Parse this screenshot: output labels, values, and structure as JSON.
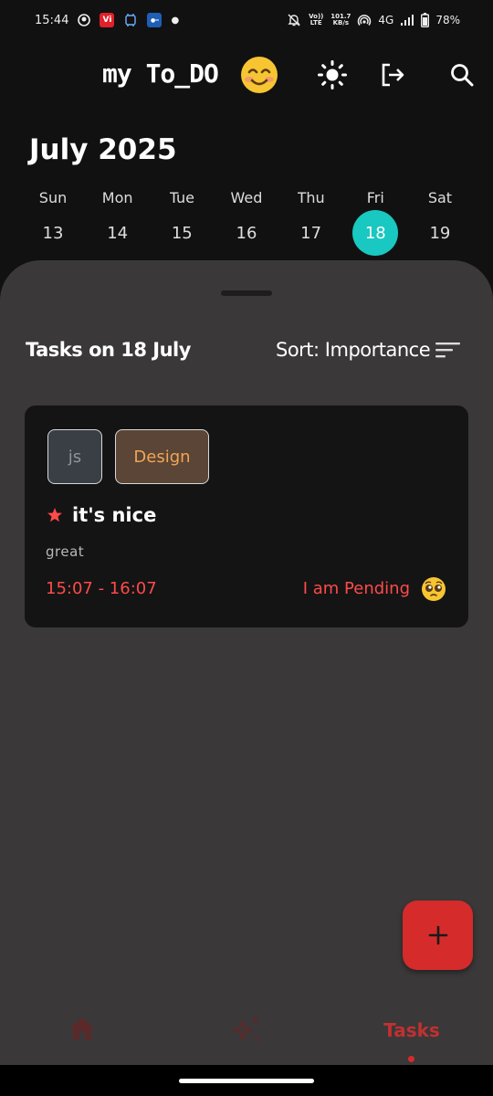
{
  "status_bar": {
    "time": "15:44",
    "net_type": "Vo)) LTE",
    "speed_value": "101.7",
    "speed_unit": "KB/s",
    "network": "4G",
    "battery": "78%"
  },
  "app_bar": {
    "title": "my To_DO",
    "title_emoji_icon": "smiling-face-icon",
    "theme_icon": "sun-icon",
    "logout_icon": "logout-icon",
    "search_icon": "search-icon"
  },
  "calendar": {
    "month_label": "July 2025",
    "days": [
      {
        "name": "Sun",
        "num": "13"
      },
      {
        "name": "Mon",
        "num": "14"
      },
      {
        "name": "Tue",
        "num": "15"
      },
      {
        "name": "Wed",
        "num": "16"
      },
      {
        "name": "Thu",
        "num": "17"
      },
      {
        "name": "Fri",
        "num": "18"
      },
      {
        "name": "Sat",
        "num": "19"
      }
    ],
    "selected_index": 5,
    "accent": "#19c8c0"
  },
  "tasks_panel": {
    "heading": "Tasks on 18 July",
    "sort_label": "Sort: Importance"
  },
  "task": {
    "tags": [
      "js",
      "Design"
    ],
    "title": "it's nice",
    "description": "great",
    "time_range": "15:07 - 16:07",
    "status": "I am Pending",
    "status_emoji_icon": "pleading-face-icon",
    "accent": "#ff4a4a"
  },
  "fab": {
    "label": "+",
    "color": "#d52b2b"
  },
  "bottom_nav": {
    "items": [
      {
        "icon": "home-icon",
        "label": ""
      },
      {
        "icon": "sparkles-icon",
        "label": ""
      },
      {
        "icon": "",
        "label": "Tasks"
      }
    ],
    "active_index": 2
  }
}
